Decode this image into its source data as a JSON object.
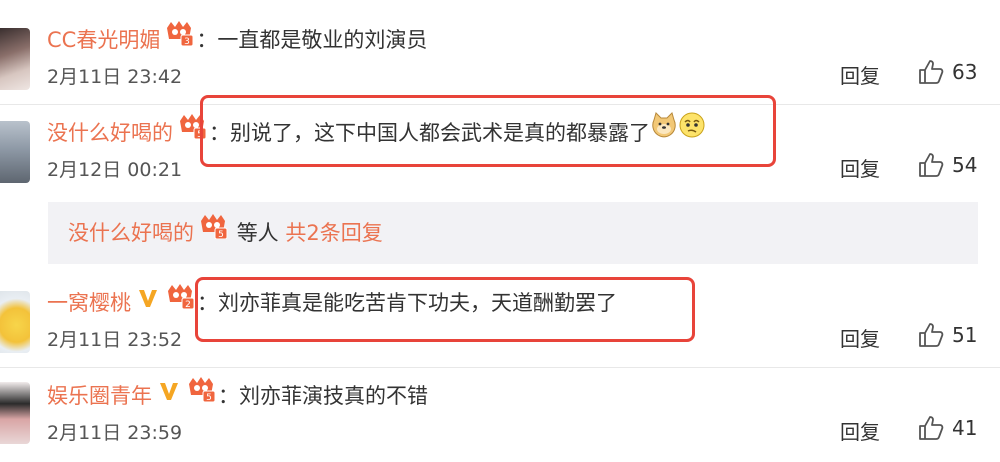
{
  "comments": [
    {
      "username": "CC春光明媚",
      "level": "3",
      "text": "一直都是敬业的刘演员",
      "time": "2月11日 23:42",
      "reply_label": "回复",
      "likes": "63"
    },
    {
      "username": "没什么好喝的",
      "level": "5",
      "text": "别说了，这下中国人都会武术是真的都暴露了",
      "time": "2月12日 00:21",
      "reply_label": "回复",
      "likes": "54",
      "emojis": [
        "doge-emoji",
        "pensive-face-emoji"
      ]
    },
    {
      "username": "一窝樱桃",
      "level": "2",
      "vip": "V",
      "text": "刘亦菲真是能吃苦肯下功夫，天道酬勤罢了",
      "time": "2月11日 23:52",
      "reply_label": "回复",
      "likes": "51"
    },
    {
      "username": "娱乐圈青年",
      "level": "5",
      "vip": "V",
      "text": "刘亦菲演技真的不错",
      "time": "2月11日 23:59",
      "reply_label": "回复",
      "likes": "41"
    }
  ],
  "sub_replies": {
    "username": "没什么好喝的",
    "level": "5",
    "suffix": "等人",
    "total": "共2条回复"
  },
  "colors": {
    "username": "#eb7350",
    "highlight": "#e8443a",
    "subbox_bg": "#f2f2f5",
    "vip": "#f5a623"
  }
}
